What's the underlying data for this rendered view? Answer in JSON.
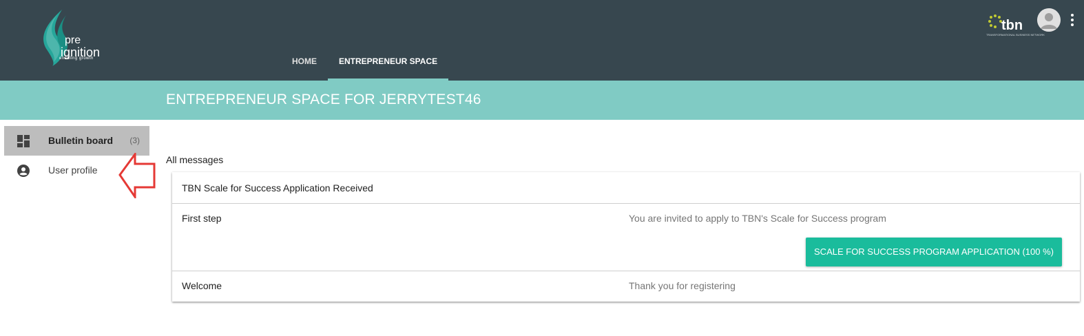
{
  "brand": {
    "logo_line1": "pre",
    "logo_line2": "ignition",
    "logo_tagline": "enabling    growth",
    "partner_logo": "tbn",
    "partner_tagline": "TRANSFORMATIONAL BUSINESS NETWORK"
  },
  "nav": {
    "tabs": [
      {
        "label": "HOME",
        "active": false
      },
      {
        "label": "ENTREPRENEUR SPACE",
        "active": true
      }
    ]
  },
  "header_icons": [
    "avatar-icon",
    "more-vert-icon"
  ],
  "band": {
    "title": "ENTREPRENEUR SPACE FOR JERRYTEST46"
  },
  "sidebar": {
    "items": [
      {
        "label": "Bulletin board",
        "count": "(3)",
        "icon": "dashboard-icon",
        "active": true
      },
      {
        "label": "User profile",
        "count": "",
        "icon": "account-circle-icon",
        "active": false
      }
    ]
  },
  "main": {
    "section_title": "All messages",
    "messages": [
      {
        "title": "TBN Scale for Success Application Received",
        "body": ""
      },
      {
        "title": "First step",
        "body": "You are invited to apply to TBN's Scale for Success program",
        "action": "SCALE FOR SUCCESS PROGRAM APPLICATION (100 %)"
      },
      {
        "title": "Welcome",
        "body": "Thank you for registering"
      }
    ]
  },
  "colors": {
    "header_bg": "#37474f",
    "band_bg": "#80cbc4",
    "accent": "#1abc9c",
    "sidebar_active": "#bdbdbd",
    "annotation_arrow": "#e53935",
    "logo_teal": "#26a69a",
    "partner_dots": "#c0ca33"
  }
}
